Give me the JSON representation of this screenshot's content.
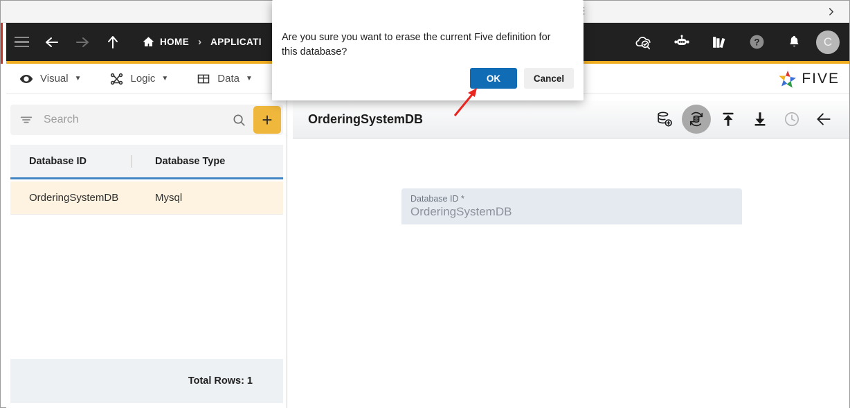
{
  "browser": {
    "menu_icon": "vertical-dots-icon",
    "forward_chevron_icon": "chevron-right-icon"
  },
  "topnav": {
    "menu_icon": "hamburger-icon",
    "back_icon": "arrow-left-icon",
    "forward_icon": "arrow-right-icon",
    "up_icon": "arrow-up-icon",
    "home_icon": "home-icon",
    "home_label": "HOME",
    "separator": "›",
    "breadcrumb_current": "APPLICATI",
    "icons": [
      {
        "name": "cloud-check-icon",
        "label": "Deploy"
      },
      {
        "name": "chat-bot-icon",
        "label": "Assistant"
      },
      {
        "name": "books-icon",
        "label": "Documentation"
      },
      {
        "name": "help-icon",
        "label": "Help"
      },
      {
        "name": "bell-icon",
        "label": "Notifications"
      }
    ],
    "avatar_initial": "C",
    "accent_color": "#f0ad20",
    "background_color": "#212121"
  },
  "modbar": {
    "items": [
      {
        "icon": "eye-icon",
        "label": "Visual",
        "caret": "▼"
      },
      {
        "icon": "logic-nodes-icon",
        "label": "Logic",
        "caret": "▼"
      },
      {
        "icon": "grid-table-icon",
        "label": "Data",
        "caret": "▼"
      }
    ],
    "logo_text": "FIVE"
  },
  "sidebar": {
    "search": {
      "placeholder": "Search",
      "value": "",
      "filter_icon": "filter-icon",
      "search_icon": "search-icon"
    },
    "add_button": {
      "label": "+",
      "icon": "plus-icon",
      "color": "#efb73b"
    },
    "table": {
      "columns": [
        "Database ID",
        "Database Type"
      ],
      "rows": [
        {
          "database_id": "OrderingSystemDB",
          "database_type": "Mysql",
          "selected": true
        }
      ],
      "header_underline_color": "#4285c5",
      "selected_row_color": "#fdf3e0"
    },
    "footer": {
      "total_rows_label": "Total Rows: 1"
    }
  },
  "detail": {
    "title": "OrderingSystemDB",
    "toolbar": [
      {
        "name": "add-database-icon",
        "label": "Add Database",
        "state": "normal"
      },
      {
        "name": "import-database-schema-icon",
        "label": "Import Database Schema",
        "state": "active"
      },
      {
        "name": "upload-icon",
        "label": "Upload",
        "state": "normal"
      },
      {
        "name": "download-icon",
        "label": "Download",
        "state": "normal"
      },
      {
        "name": "history-clock-icon",
        "label": "History",
        "state": "disabled"
      },
      {
        "name": "back-arrow-icon",
        "label": "Back",
        "state": "normal"
      }
    ],
    "tooltip": "Import Database Schema",
    "form": {
      "database_id": {
        "label": "Database ID *",
        "value": "OrderingSystemDB"
      }
    }
  },
  "dialog": {
    "message": "Are you sure you want to erase the current Five definition for this database?",
    "ok_label": "OK",
    "cancel_label": "Cancel",
    "ok_color": "#0f6cb5"
  },
  "annotation": {
    "arrow_color": "#e8251f",
    "points_to": "ok-button"
  }
}
